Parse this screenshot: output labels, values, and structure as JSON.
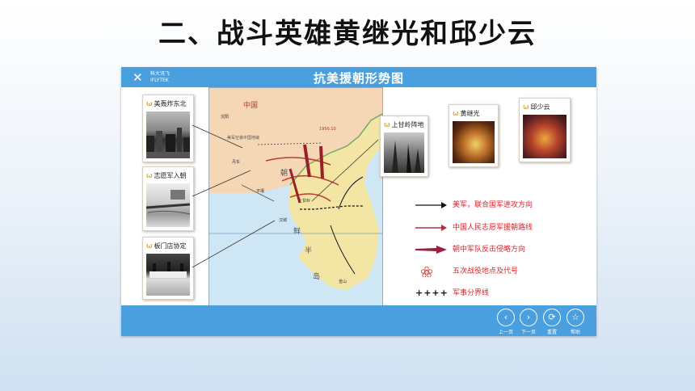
{
  "slide": {
    "title": "二、战斗英雄黄继光和邱少云"
  },
  "app": {
    "brand_mark": "✕",
    "brand_name": "科大讯飞",
    "brand_sub": "iFLYTEK",
    "title": "抗美援朝形势图"
  },
  "cards": {
    "northeast": {
      "label": "美轰炸东北"
    },
    "volunteers": {
      "label": "志愿军入朝"
    },
    "panmunjom": {
      "label": "板门店协定"
    },
    "shangganling": {
      "label": "上甘岭阵地"
    },
    "huangjiguang": {
      "label": "黄继光"
    },
    "qiushaoyun": {
      "label": "邱少云"
    }
  },
  "map": {
    "china_label": "中国",
    "korea_chars": [
      "朝",
      "鲜",
      "半",
      "岛"
    ],
    "places": [
      "沈阳",
      "丹东",
      "平壤",
      "汉城",
      "上甘岭",
      "釜山"
    ],
    "note": "美军空袭中国地域",
    "line_label": "1950.10"
  },
  "legend": [
    {
      "label": "美军，联合国军进攻方向",
      "symbol": "black-arrow"
    },
    {
      "label": "中国人民志愿军援朝路线",
      "symbol": "red-arrow"
    },
    {
      "label": "朝中军队反击侵略方向",
      "symbol": "red-wedge-arrow"
    },
    {
      "label": "五次战役地点及代号",
      "symbol": "battle-flower"
    },
    {
      "label": "军事分界线",
      "symbol": "demarcation-line",
      "glyph": "++++"
    }
  ],
  "nav": {
    "prev": {
      "label": "上一页",
      "icon": "prev-icon",
      "glyph": "‹"
    },
    "next": {
      "label": "下一页",
      "icon": "next-icon",
      "glyph": "›"
    },
    "reset": {
      "label": "重置",
      "icon": "refresh-icon",
      "glyph": "⟳"
    },
    "help": {
      "label": "帮助",
      "icon": "help-icon",
      "glyph": "☆"
    }
  },
  "colors": {
    "bar": "#4aa0de",
    "legend_text": "#d8262e"
  }
}
